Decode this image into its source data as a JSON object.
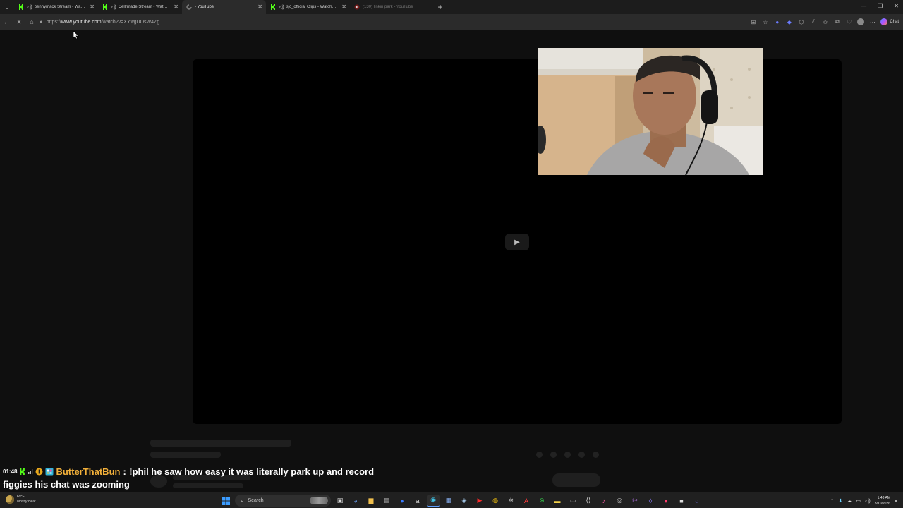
{
  "tabs": [
    {
      "title": "bennymack Stream - Watch Live",
      "favicon": "kick-icon",
      "audio": true,
      "active": false
    },
    {
      "title": "Cellfmade Stream - Watch Live",
      "favicon": "kick-icon",
      "audio": true,
      "active": false
    },
    {
      "title": "- YouTube",
      "favicon": "loading-icon",
      "audio": false,
      "active": true
    },
    {
      "title": "sjc_official Clips - Watch Live",
      "favicon": "kick-icon",
      "audio": true,
      "active": false
    },
    {
      "title": "(130) linkin park - YouTube",
      "favicon": "youtube-icon",
      "audio": false,
      "active": false,
      "dimmed": true
    }
  ],
  "address_bar": {
    "scheme": "https://",
    "host": "www.youtube.com",
    "path": "/watch?v=XYwgUOsW4Zg"
  },
  "toolbar": {
    "chat_label": "Chat"
  },
  "chat_overlay": {
    "time": "01:48",
    "username": "ButterThatBun",
    "separator": ":",
    "message_line1": "!phil he saw how easy it was literally park up and record",
    "message_line2": "figgies his chat was zooming"
  },
  "taskbar": {
    "weather_temp": "69°F",
    "weather_desc": "Mostly clear",
    "search_placeholder": "Search",
    "time": "1:48 AM",
    "date": "8/10/2026"
  },
  "colors": {
    "kick_green": "#53fc18",
    "username_color": "#f2b03a",
    "youtube_red": "#ff0000"
  }
}
